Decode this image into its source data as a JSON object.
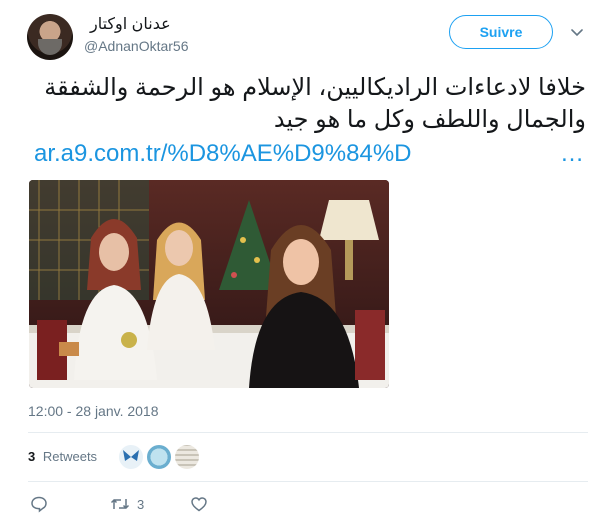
{
  "tweet": {
    "author_name": "عدنان اوكتار",
    "author_handle": "@AdnanOktar56",
    "follow_label": "Suivre",
    "text_line1": "خلافا لادعاءات الراديكاليين، الإسلام هو الرحمة والشفقة",
    "text_line2": "والجمال واللطف وكل ما هو جيد",
    "link_text": "ar.a9.com.tr/%D8%AE%D9%84%D",
    "link_ellipsis": "…",
    "timestamp": "12:00 - 28 janv. 2018",
    "retweet_count": "3",
    "retweets_label": "Retweets",
    "action_retweet_count": "3"
  },
  "icons": {
    "reply": "reply-icon",
    "retweet": "retweet-icon",
    "like": "heart-icon",
    "caret": "chevron-down-icon"
  },
  "colors": {
    "accent": "#1da1f2",
    "link": "#1b95e0",
    "muted": "#657786",
    "divider": "#e6ecf0"
  }
}
